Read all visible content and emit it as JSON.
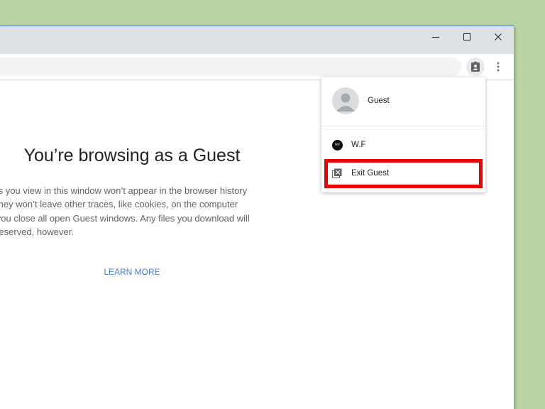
{
  "profile_menu": {
    "guest_name": "Guest",
    "other_profile": {
      "name": "W.F",
      "initials": "WF"
    },
    "exit_label": "Exit Guest"
  },
  "page": {
    "headline": "You’re browsing as a Guest",
    "body_lines": [
      "ages you view in this window won’t appear in the browser history",
      "nd they won’t leave other traces, like cookies, on the computer",
      "ter you close all open Guest windows. Any files you download will",
      "e preserved, however."
    ],
    "learn_more": "LEARN MORE"
  },
  "icons": {
    "minimize": "minimize-icon",
    "maximize": "maximize-icon",
    "close": "close-icon",
    "profile": "guest-profile-icon",
    "menu": "more-vert-icon",
    "exit": "exit-guest-icon"
  },
  "colors": {
    "highlight": "#ee0000",
    "link": "#4a7bd4",
    "background": "#b9d3a3"
  }
}
